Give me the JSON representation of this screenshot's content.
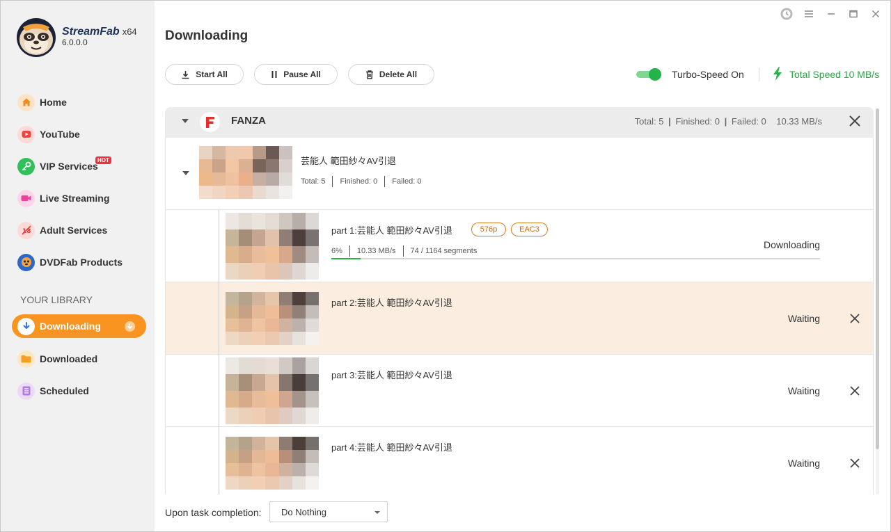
{
  "app": {
    "brand": "StreamFab",
    "arch": "x64",
    "version": "6.0.0.0"
  },
  "sidebar": {
    "items": [
      {
        "label": "Home",
        "icon": "home-icon",
        "color": "#f6a23a"
      },
      {
        "label": "YouTube",
        "icon": "youtube-icon",
        "color": "#f5534f"
      },
      {
        "label": "VIP Services",
        "icon": "key-icon",
        "color": "#35c35a",
        "badge": "HOT"
      },
      {
        "label": "Live Streaming",
        "icon": "live-camera-icon",
        "color": "#f34fa6"
      },
      {
        "label": "Adult Services",
        "icon": "adult-18-icon",
        "color": "#f0564e"
      },
      {
        "label": "DVDFab Products",
        "icon": "dvdfab-icon",
        "color": "#2d67c9"
      }
    ],
    "library_title": "YOUR LIBRARY",
    "library": [
      {
        "label": "Downloading",
        "icon": "download-icon",
        "active": true
      },
      {
        "label": "Downloaded",
        "icon": "folder-icon",
        "color": "#f7a52a"
      },
      {
        "label": "Scheduled",
        "icon": "schedule-list-icon",
        "color": "#b67fe0"
      }
    ]
  },
  "header": {
    "title": "Downloading",
    "start_all": "Start All",
    "pause_all": "Pause All",
    "delete_all": "Delete All",
    "turbo_label": "Turbo-Speed On",
    "total_speed": "Total Speed 10 MB/s"
  },
  "group": {
    "name": "FANZA",
    "total": "Total: 5",
    "finished": "Finished: 0",
    "failed": "Failed: 0",
    "speed": "10.33 MB/s"
  },
  "subgroup": {
    "title": "芸能人 範田紗々AV引退",
    "total": "Total: 5",
    "finished": "Finished: 0",
    "failed": "Failed: 0"
  },
  "items": [
    {
      "title": "part 1:芸能人 範田紗々AV引退",
      "badges": [
        "576p",
        "EAC3"
      ],
      "percent": "6%",
      "speed": "10.33 MB/s",
      "segments": "74 / 1164 segments",
      "progress": 0.06,
      "status": "Downloading"
    },
    {
      "title": "part 2:芸能人 範田紗々AV引退",
      "status": "Waiting"
    },
    {
      "title": "part 3:芸能人 範田紗々AV引退",
      "status": "Waiting"
    },
    {
      "title": "part 4:芸能人 範田紗々AV引退",
      "status": "Waiting"
    }
  ],
  "footer": {
    "label": "Upon task completion:",
    "selected": "Do Nothing"
  },
  "colors": {
    "accent": "#f99420",
    "success": "#28a745",
    "badge": "#c26c12"
  }
}
